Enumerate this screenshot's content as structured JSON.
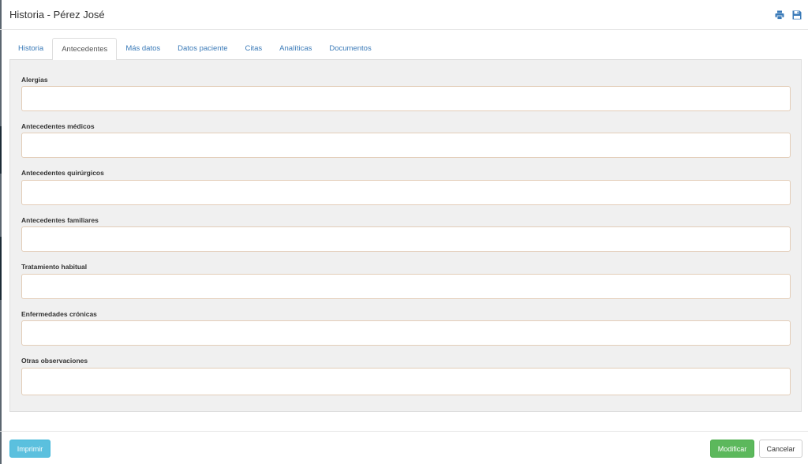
{
  "header": {
    "title": "Historia - Pérez José",
    "icons": [
      "print-icon",
      "save-icon"
    ],
    "accent_color": "#3a7ab8"
  },
  "tabs": [
    {
      "label": "Historia",
      "active": false
    },
    {
      "label": "Antecedentes",
      "active": true
    },
    {
      "label": "Más datos",
      "active": false
    },
    {
      "label": "Datos paciente",
      "active": false
    },
    {
      "label": "Citas",
      "active": false
    },
    {
      "label": "Analíticas",
      "active": false
    },
    {
      "label": "Documentos",
      "active": false
    }
  ],
  "form": {
    "fields": [
      {
        "label": "Alergias",
        "value": ""
      },
      {
        "label": "Antecedentes médicos",
        "value": ""
      },
      {
        "label": "Antecedentes quirúrgicos",
        "value": ""
      },
      {
        "label": "Antecedentes familiares",
        "value": ""
      },
      {
        "label": "Tratamiento habitual",
        "value": ""
      },
      {
        "label": "Enfermedades crónicas",
        "value": ""
      },
      {
        "label": "Otras observaciones",
        "value": ""
      }
    ]
  },
  "footer": {
    "print_label": "Imprimir",
    "modify_label": "Modificar",
    "cancel_label": "Cancelar",
    "print_color": "#5bc0de",
    "modify_color": "#5cb85c"
  }
}
